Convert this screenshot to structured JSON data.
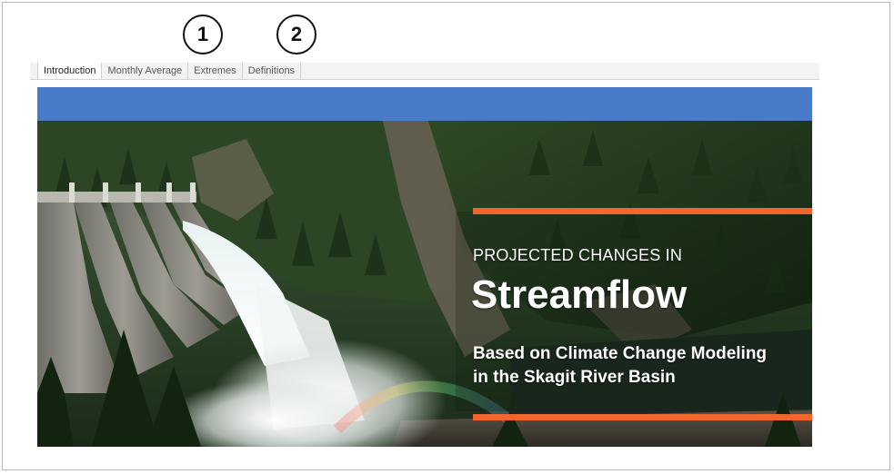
{
  "callouts": [
    "1",
    "2"
  ],
  "tabs": [
    {
      "label": "Introduction",
      "active": true
    },
    {
      "label": "Monthly Average",
      "active": false
    },
    {
      "label": "Extremes",
      "active": false
    },
    {
      "label": "Definitions",
      "active": false
    }
  ],
  "hero": {
    "kicker": "PROJECTED CHANGES IN",
    "headline": "Streamflow",
    "subline_1": "Based on Climate Change Modeling",
    "subline_2": "in the Skagit River Basin"
  },
  "colors": {
    "header_bar": "#4a7bc8",
    "accent_lines": "#f2652d"
  }
}
